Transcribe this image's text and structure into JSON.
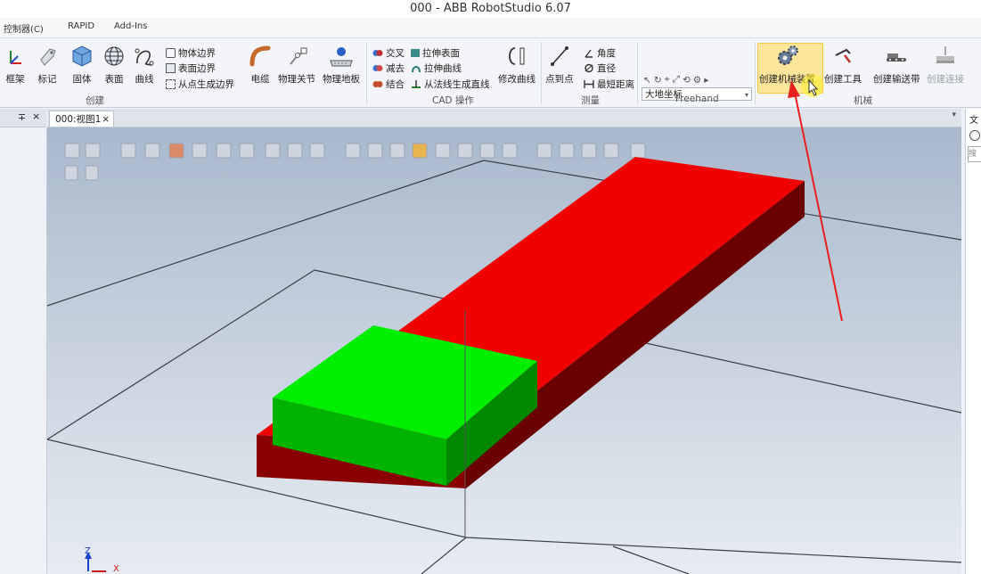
{
  "window": {
    "title": "000 - ABB RobotStudio 6.07"
  },
  "menu": [
    "控制器(C)",
    "RAPID",
    "Add-Ins"
  ],
  "ribbon": {
    "create": {
      "frame": "框架",
      "mark": "标记",
      "solid": "固体",
      "surface": "表面",
      "curve": "曲线",
      "body_boundary": "物体边界",
      "surface_boundary": "表面边界",
      "point_boundary": "从点生成边界",
      "cable": "电缆",
      "physics_joint": "物理关节",
      "physics_floor": "物理地板",
      "group": "创建"
    },
    "cad": {
      "intersect": "交叉",
      "subtract": "减去",
      "union": "结合",
      "extrude_surface": "拉伸表面",
      "extrude_curve": "拉伸曲线",
      "normal_line": "从法线生成直线",
      "modify_curve": "修改曲线",
      "group": "CAD 操作"
    },
    "measure": {
      "point_to_point": "点到点",
      "angle": "角度",
      "diameter": "直径",
      "min_distance": "最短距离",
      "group": "测量"
    },
    "freehand": {
      "coord_system": "大地坐标",
      "group": "Freehand"
    },
    "mechanism": {
      "create_mechanism": "创建机械装置",
      "create_tool": "创建工具",
      "create_conveyor": "创建输送带",
      "create_connection": "创建连接",
      "group": "机械"
    }
  },
  "view_tab": {
    "label": "000:视图1",
    "close": "×"
  },
  "left_panel": {
    "pin": "∓",
    "close": "×"
  },
  "right_panel": {
    "label": "文",
    "search": "搜"
  },
  "axes": {
    "x": "X",
    "z": "Z"
  },
  "colors": {
    "accent_red": "#f00000",
    "accent_green": "#00ee00",
    "highlight": "#fde59a",
    "arrow": "#e82020"
  }
}
